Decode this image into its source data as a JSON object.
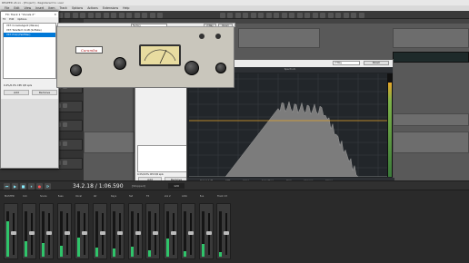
{
  "app": {
    "title": "REAPER v6.xx - [Project] - Registered to: user",
    "menu": [
      "File",
      "Edit",
      "View",
      "Insert",
      "Item",
      "Track",
      "Options",
      "Actions",
      "Extensions",
      "Help"
    ]
  },
  "fx_window": {
    "title": "FX: Track 1 \"Vocals 2\"",
    "menu": [
      "FX",
      "Edit",
      "Options"
    ],
    "items": [
      "VST: ConsoleAgent (Waves)",
      "VST: TubeTech CL1B (Softube)",
      "VST: ProQ (FabFilter)"
    ],
    "selected_index": 2,
    "cpu": "0.4%/0.0% CPU 0/0 spls",
    "add_button": "Add",
    "remove_button": "Remove",
    "cpu_b": "0.4%/0.0% CPU 0/0 spls",
    "add_button_b": "Add",
    "remove_button_b": "Remove"
  },
  "plugin": {
    "brand": "Caramba",
    "preset": "Factory",
    "button": "2-Way",
    "param": "Param",
    "knob_labels": [
      "GAIN",
      "RATIO",
      "ATTACK",
      "RELEASE",
      "OUTPUT"
    ]
  },
  "analyzer": {
    "title": "Spectrum",
    "preset": "2-Way",
    "param": "Param",
    "freq_labels": [
      "20",
      "50",
      "100",
      "200",
      "500",
      "1k",
      "2k",
      "5k",
      "10k",
      "20k"
    ],
    "db_labels": [
      "+12",
      "0",
      "-12",
      "-24",
      "-36",
      "-48",
      "-60",
      "-72"
    ],
    "footer": [
      "Peak 0.0 dB",
      "RMS",
      "Slope",
      "Smoothing",
      "Hold",
      "Channel",
      "Stereo"
    ]
  },
  "tracks": [
    "Track 1",
    "Track 2",
    "Track 3",
    "Track 4",
    "Track 5",
    "Track 6",
    "Track 7",
    "Track 8"
  ],
  "transport": {
    "time": "34.2.18 / 1:06.590",
    "rate": "[Stopped]",
    "bpm": "120"
  },
  "mixer": {
    "channels": [
      {
        "name": "MASTER",
        "level": 0.78
      },
      {
        "name": "Kick",
        "level": 0.35
      },
      {
        "name": "Snare",
        "level": 0.3
      },
      {
        "name": "Bass",
        "level": 0.25
      },
      {
        "name": "Vocal",
        "level": 0.42
      },
      {
        "name": "Gtr",
        "level": 0.2
      },
      {
        "name": "Keys",
        "level": 0.18
      },
      {
        "name": "Pad",
        "level": 0.22
      },
      {
        "name": "FX",
        "level": 0.15
      },
      {
        "name": "Vox 2",
        "level": 0.4
      },
      {
        "name": "Amb",
        "level": 0.12
      },
      {
        "name": "Bus",
        "level": 0.28
      },
      {
        "name": "Track 13",
        "level": 0.1
      }
    ]
  },
  "colors": {
    "accent": "#0078d7",
    "meter": "#2fc46a",
    "spectrum": "#8b8b8b",
    "line": "#e7a62a"
  }
}
